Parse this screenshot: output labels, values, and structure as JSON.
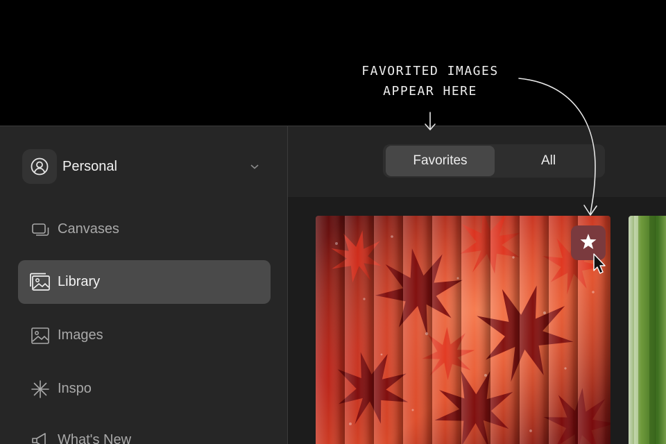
{
  "annotation": {
    "line1": "FAVORITED IMAGES",
    "line2": "APPEAR HERE"
  },
  "account": {
    "name": "Personal",
    "icon": "user-circle-icon"
  },
  "sidebar": {
    "items": [
      {
        "label": "Canvases",
        "icon": "canvases-icon",
        "active": false
      },
      {
        "label": "Library",
        "icon": "library-icon",
        "active": true
      },
      {
        "label": "Images",
        "icon": "image-icon",
        "active": false
      },
      {
        "label": "Inspo",
        "icon": "sparkle-icon",
        "active": false
      },
      {
        "label": "What's New",
        "icon": "megaphone-icon",
        "active": false
      }
    ]
  },
  "tabs": [
    {
      "label": "Favorites",
      "active": true
    },
    {
      "label": "All",
      "active": false
    }
  ],
  "favorite_button": {
    "icon": "star-icon",
    "color": "#7a3a3e"
  },
  "colors": {
    "background": "#000000",
    "sidebar": "#262626",
    "active_nav": "#4a4a4a",
    "main": "#242424"
  }
}
